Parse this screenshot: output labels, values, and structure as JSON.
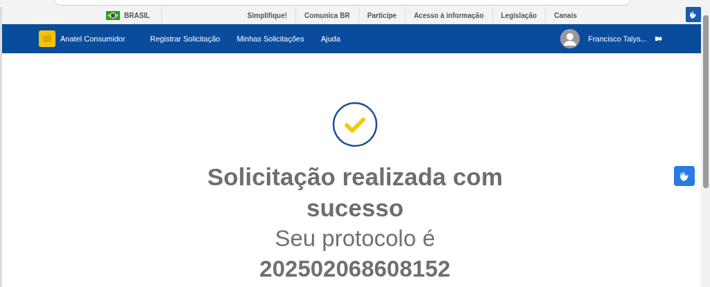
{
  "gov_bar": {
    "country": "BRASIL",
    "links": [
      "Simplifique!",
      "Comunica BR",
      "Participe",
      "Acesso à informação",
      "Legislação",
      "Canais"
    ]
  },
  "header": {
    "app_name": "Anatel Consumidor",
    "nav": [
      "Registrar Solicitação",
      "Minhas Solicitações",
      "Ajuda"
    ],
    "user_name": "Francisco Talys..."
  },
  "message": {
    "title": "Solicitação realizada com sucesso",
    "protocol_text": "Seu protocolo é **202502068608152**"
  }
}
